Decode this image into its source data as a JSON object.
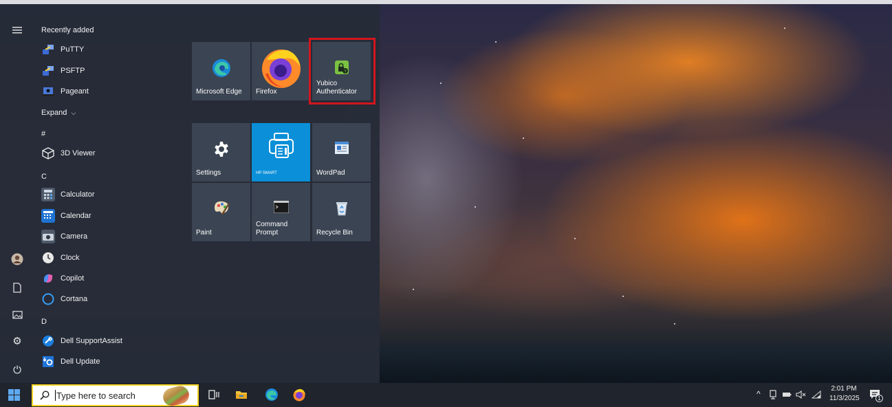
{
  "start_menu": {
    "list_header_recent": "Recently added",
    "recent_apps": [
      {
        "label": "PuTTY",
        "icon": "putty-icon"
      },
      {
        "label": "PSFTP",
        "icon": "psftp-icon"
      },
      {
        "label": "Pageant",
        "icon": "pageant-icon"
      }
    ],
    "expand_label": "Expand",
    "groups": {
      "hash": "#",
      "c": "C",
      "d": "D"
    },
    "apps": [
      {
        "label": "3D Viewer",
        "icon": "3d-viewer-icon"
      },
      {
        "label": "Calculator",
        "icon": "calculator-icon"
      },
      {
        "label": "Calendar",
        "icon": "calendar-icon"
      },
      {
        "label": "Camera",
        "icon": "camera-icon"
      },
      {
        "label": "Clock",
        "icon": "clock-icon"
      },
      {
        "label": "Copilot",
        "icon": "copilot-icon"
      },
      {
        "label": "Cortana",
        "icon": "cortana-icon"
      },
      {
        "label": "Dell SupportAssist",
        "icon": "dell-supportassist-icon"
      },
      {
        "label": "Dell Update",
        "icon": "dell-update-icon"
      }
    ],
    "rail": [
      "hamburger-icon",
      "user-avatar-icon",
      "documents-icon",
      "pictures-icon",
      "settings-icon",
      "power-icon"
    ],
    "tiles": [
      {
        "label": "Microsoft Edge",
        "icon": "edge-icon"
      },
      {
        "label": "Firefox",
        "icon": "firefox-icon"
      },
      {
        "label": "Yubico Authenticator",
        "icon": "yubico-authenticator-icon"
      },
      {
        "label": "Settings",
        "icon": "gear-icon"
      },
      {
        "label": "HP SMART",
        "icon": "hp-smart-icon"
      },
      {
        "label": "WordPad",
        "icon": "wordpad-icon"
      },
      {
        "label": "Paint",
        "icon": "paint-icon"
      },
      {
        "label": "Command Prompt",
        "icon": "command-prompt-icon"
      },
      {
        "label": "Recycle Bin",
        "icon": "recycle-bin-icon"
      }
    ]
  },
  "taskbar": {
    "search_placeholder": "Type here to search",
    "pinned": [
      "task-view-icon",
      "file-explorer-icon",
      "edge-icon",
      "firefox-icon"
    ],
    "tray": {
      "time": "2:01 PM",
      "date": "11/3/2025",
      "notification_count": "1"
    }
  },
  "colors": {
    "start_bg": "#262c38",
    "tile_bg": "#3b4452",
    "hp_tile_bg": "#0a8fd8",
    "highlight_border": "#d3151c",
    "search_border": "#f5d31e"
  }
}
